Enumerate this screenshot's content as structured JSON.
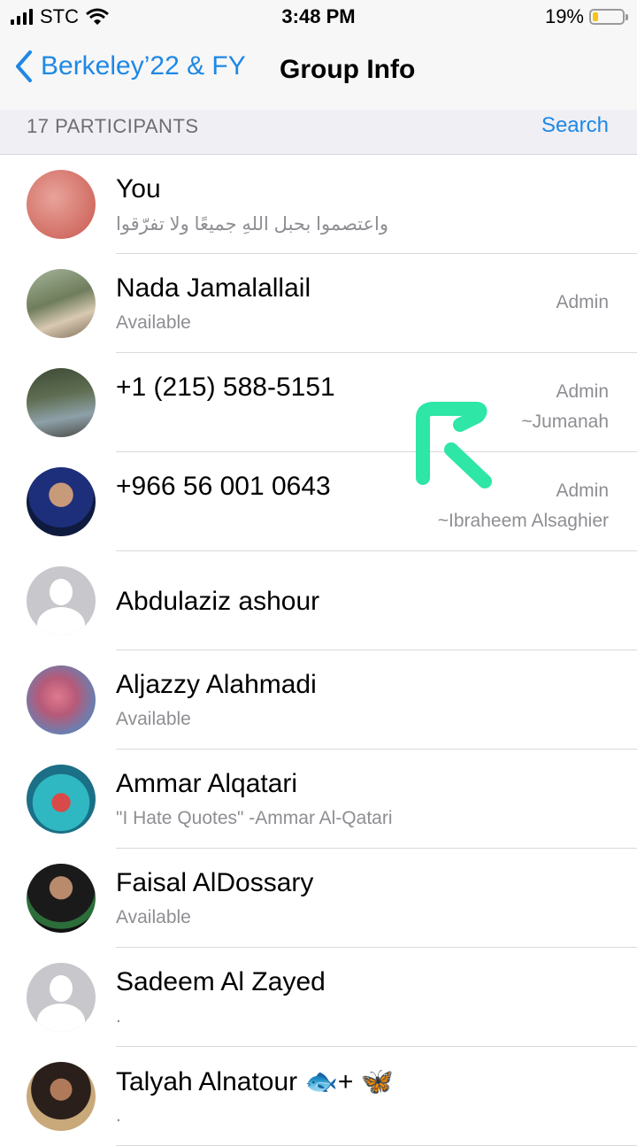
{
  "status_bar": {
    "carrier": "STC",
    "time": "3:48 PM",
    "battery": "19%",
    "battery_level": 0.19
  },
  "nav": {
    "back_label": "Berkeley’22 & FY",
    "title": "Group Info"
  },
  "section": {
    "count": "17 PARTICIPANTS",
    "search": "Search"
  },
  "participants": [
    {
      "name": "You",
      "status": "واعتصموا بحبل اللهِ جميعًا ولا تفرّقوا"
    },
    {
      "name": "Nada Jamalallail",
      "status": "Available",
      "admin": "Admin"
    },
    {
      "name": "+1 (215) 588-5151",
      "admin": "Admin",
      "pushname": "~Jumanah"
    },
    {
      "name": "+966 56 001 0643",
      "admin": "Admin",
      "pushname": "~Ibraheem Alsaghier"
    },
    {
      "name": "Abdulaziz ashour"
    },
    {
      "name": "Aljazzy Alahmadi",
      "status": "Available"
    },
    {
      "name": "Ammar Alqatari",
      "status": "\"I Hate Quotes\" -Ammar Al-Qatari"
    },
    {
      "name": "Faisal AlDossary",
      "status": "Available"
    },
    {
      "name": "Sadeem Al Zayed",
      "status": "."
    },
    {
      "name": "Talyah Alnatour 🐟+ 🦋",
      "status": "."
    }
  ],
  "colors": {
    "accent": "#1e88e5",
    "logo": "#2ee6a6",
    "battery": "#f5c518"
  }
}
